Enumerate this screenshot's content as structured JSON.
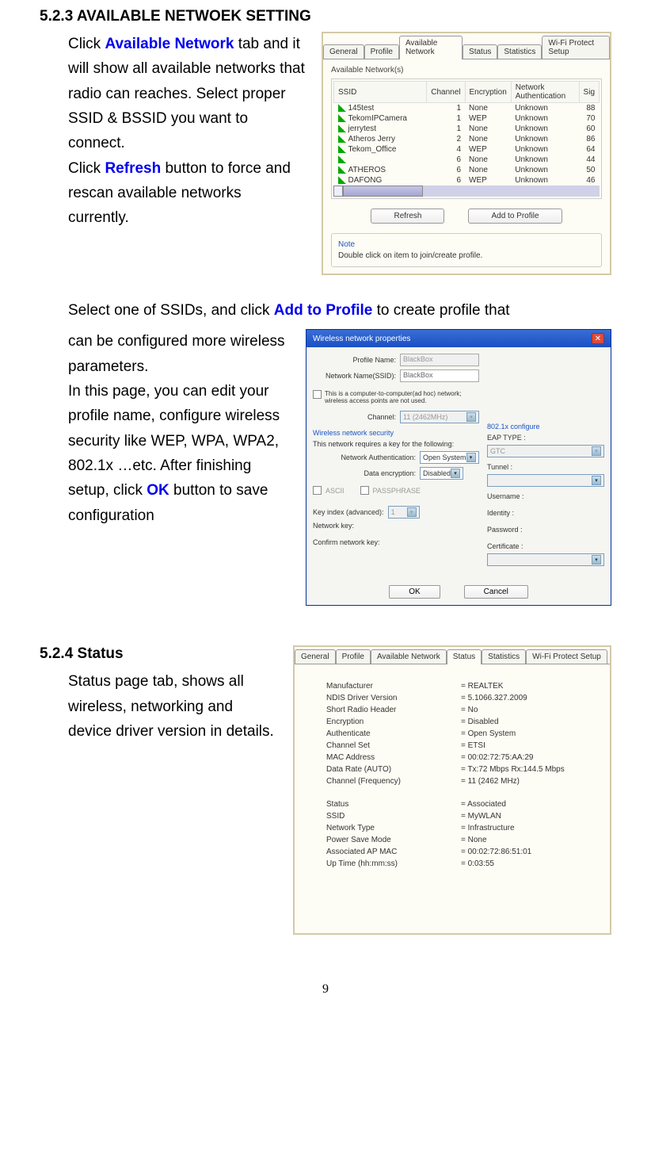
{
  "section1": {
    "heading": "5.2.3 AVAILABLE NETWOEK SETTING",
    "p1_a": "Click ",
    "p1_b": "Available Network",
    "p1_c": " tab and it will show all available networks that radio can reaches. Select proper SSID & BSSID you want to connect.",
    "p2_a": "Click ",
    "p2_b": "Refresh",
    "p2_c": " button to force and rescan available networks currently."
  },
  "panel1": {
    "tabs": [
      "General",
      "Profile",
      "Available Network",
      "Status",
      "Statistics",
      "Wi-Fi Protect Setup"
    ],
    "group_label": "Available Network(s)",
    "headers": [
      "SSID",
      "Channel",
      "Encryption",
      "Network Authentication",
      "Sig"
    ],
    "rows": [
      {
        "ssid": "145test",
        "ch": "1",
        "enc": "None",
        "auth": "Unknown",
        "sig": "88"
      },
      {
        "ssid": "TekomIPCamera",
        "ch": "1",
        "enc": "WEP",
        "auth": "Unknown",
        "sig": "70"
      },
      {
        "ssid": "jerrytest",
        "ch": "1",
        "enc": "None",
        "auth": "Unknown",
        "sig": "60"
      },
      {
        "ssid": "Atheros Jerry",
        "ch": "2",
        "enc": "None",
        "auth": "Unknown",
        "sig": "86"
      },
      {
        "ssid": "Tekom_Office",
        "ch": "4",
        "enc": "WEP",
        "auth": "Unknown",
        "sig": "64"
      },
      {
        "ssid": "",
        "ch": "6",
        "enc": "None",
        "auth": "Unknown",
        "sig": "44"
      },
      {
        "ssid": "ATHEROS",
        "ch": "6",
        "enc": "None",
        "auth": "Unknown",
        "sig": "50"
      },
      {
        "ssid": "DAFONG",
        "ch": "6",
        "enc": "WEP",
        "auth": "Unknown",
        "sig": "46"
      }
    ],
    "refresh_btn": "Refresh",
    "add_profile_btn": "Add to Profile",
    "note_title": "Note",
    "note_text": "Double click on item to join/create profile."
  },
  "section2": {
    "intro_a": "Select one of SSIDs, and click ",
    "intro_b": "Add to Profile",
    "intro_c": " to create profile that",
    "p1_a": "can be configured more wireless parameters.",
    "p2_a": "In this page, you can edit your profile name, configure wireless security like WEP, WPA, WPA2, 802.1x …etc. After finishing setup, click ",
    "p2_b": "OK",
    "p2_c": " button to save configuration"
  },
  "panel2": {
    "title": "Wireless network properties",
    "profile_name_label": "Profile Name:",
    "profile_name_val": "BlackBox",
    "ssid_label": "Network Name(SSID):",
    "ssid_val": "BlackBox",
    "adhoc_text": "This is a computer-to-computer(ad hoc) network; wireless access points are not used.",
    "channel_label": "Channel:",
    "channel_val": "11 (2462MHz)",
    "wns_header": "Wireless network security",
    "wns_text": "This network requires a key for the following:",
    "auth_label": "Network Authentication:",
    "auth_val": "Open System",
    "enc_label": "Data encryption:",
    "enc_val": "Disabled",
    "ascii_label": "ASCII",
    "pass_label": "PASSPHRASE",
    "keyidx_label": "Key index (advanced):",
    "keyidx_val": "1",
    "netkey_label": "Network key:",
    "confirm_label": "Confirm network key:",
    "cfg_header": "802.1x configure",
    "eap_label": "EAP TYPE :",
    "eap_val": "GTC",
    "tunnel_label": "Tunnel :",
    "user_label": "Username :",
    "identity_label": "Identity :",
    "password_label": "Password :",
    "cert_label": "Certificate :",
    "ok_btn": "OK",
    "cancel_btn": "Cancel"
  },
  "section3": {
    "heading": "5.2.4 Status",
    "p1": "Status page tab, shows all wireless, networking and device driver version in details."
  },
  "panel3": {
    "tabs": [
      "General",
      "Profile",
      "Available Network",
      "Status",
      "Statistics",
      "Wi-Fi Protect Setup"
    ],
    "rows1": [
      {
        "k": "Manufacturer",
        "v": "= REALTEK"
      },
      {
        "k": "NDIS Driver Version",
        "v": "= 5.1066.327.2009"
      },
      {
        "k": "Short Radio Header",
        "v": "= No"
      },
      {
        "k": "Encryption",
        "v": "= Disabled"
      },
      {
        "k": "Authenticate",
        "v": "= Open System"
      },
      {
        "k": "Channel Set",
        "v": "= ETSI"
      },
      {
        "k": "MAC Address",
        "v": "= 00:02:72:75:AA:29"
      },
      {
        "k": "Data Rate (AUTO)",
        "v": "= Tx:72 Mbps Rx:144.5 Mbps"
      },
      {
        "k": "Channel (Frequency)",
        "v": "= 11 (2462 MHz)"
      }
    ],
    "rows2": [
      {
        "k": "Status",
        "v": "= Associated"
      },
      {
        "k": "SSID",
        "v": "= MyWLAN"
      },
      {
        "k": "Network Type",
        "v": "= Infrastructure"
      },
      {
        "k": "Power Save Mode",
        "v": "= None"
      },
      {
        "k": "Associated AP MAC",
        "v": "= 00:02:72:86:51:01"
      },
      {
        "k": "Up Time (hh:mm:ss)",
        "v": "= 0:03:55"
      }
    ]
  },
  "page_number": "9"
}
